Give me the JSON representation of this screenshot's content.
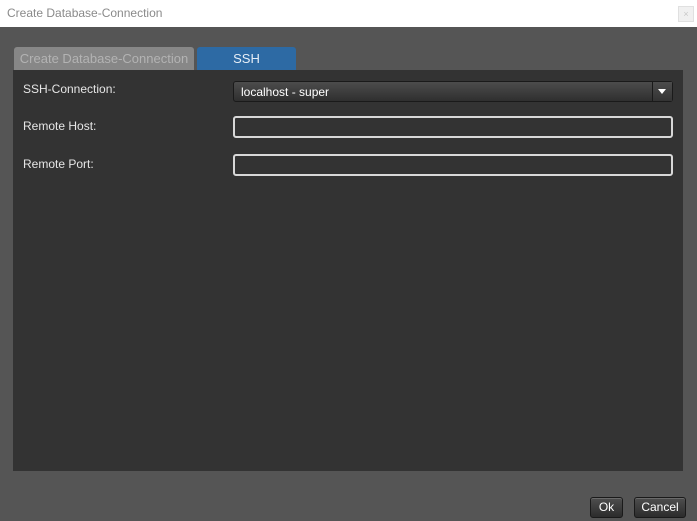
{
  "window": {
    "title": "Create Database-Connection",
    "close_glyph": "×"
  },
  "tabs": [
    {
      "label": "Create Database-Connection",
      "active": false
    },
    {
      "label": "SSH",
      "active": true
    }
  ],
  "form": {
    "ssh_connection": {
      "label": "SSH-Connection:",
      "value": "localhost - super",
      "icon": "chevron-down-icon"
    },
    "remote_host": {
      "label": "Remote Host:",
      "value": "",
      "placeholder": ""
    },
    "remote_port": {
      "label": "Remote Port:",
      "value": "",
      "placeholder": ""
    }
  },
  "buttons": {
    "ok": "Ok",
    "cancel": "Cancel"
  },
  "colors": {
    "background": "#555555",
    "panel": "#333333",
    "active_tab": "#2d6aa4",
    "inactive_tab": "#878787"
  }
}
